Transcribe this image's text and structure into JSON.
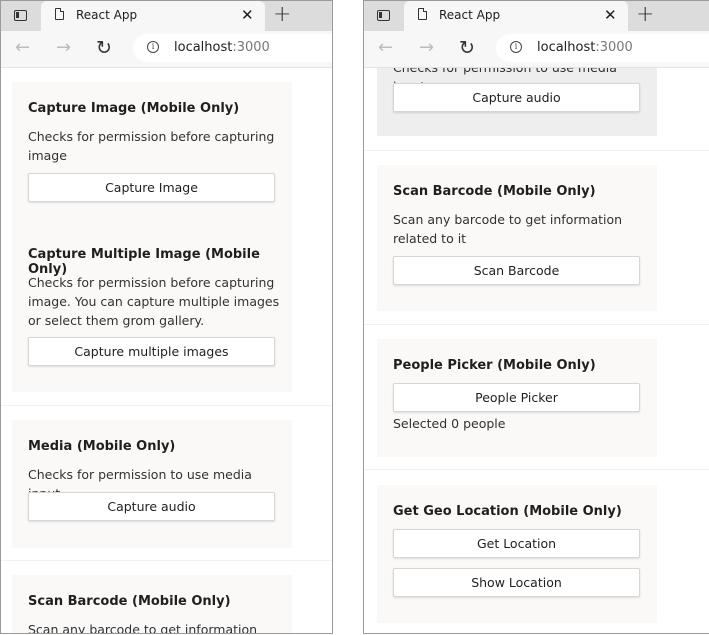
{
  "browser": {
    "tab_title": "React App",
    "tab_close": "✕",
    "new_tab": "+",
    "url_host": "localhost",
    "url_port": ":3000"
  },
  "left": {
    "capture_image": {
      "title": "Capture Image (Mobile Only)",
      "desc": "Checks for permission before capturing image",
      "button": "Capture Image"
    },
    "capture_multiple": {
      "title": "Capture Multiple Image (Mobile Only)",
      "desc": "Checks for permission before capturing image. You can capture multiple images or select them grom gallery.",
      "button": "Capture multiple images"
    },
    "media": {
      "title": "Media (Mobile Only)",
      "desc": "Checks for permission to use media input",
      "button": "Capture audio"
    },
    "scan_barcode": {
      "title": "Scan Barcode (Mobile Only)",
      "desc": "Scan any barcode to get information"
    }
  },
  "right": {
    "media": {
      "desc": "Checks for permission to use media input",
      "button": "Capture audio"
    },
    "scan_barcode": {
      "title": "Scan Barcode (Mobile Only)",
      "desc": "Scan any barcode to get information related to it",
      "button": "Scan Barcode"
    },
    "people_picker": {
      "title": "People Picker (Mobile Only)",
      "button": "People Picker",
      "status": "Selected 0 people"
    },
    "geo_location": {
      "title": "Get Geo Location (Mobile Only)",
      "button_get": "Get Location",
      "button_show": "Show Location"
    }
  }
}
